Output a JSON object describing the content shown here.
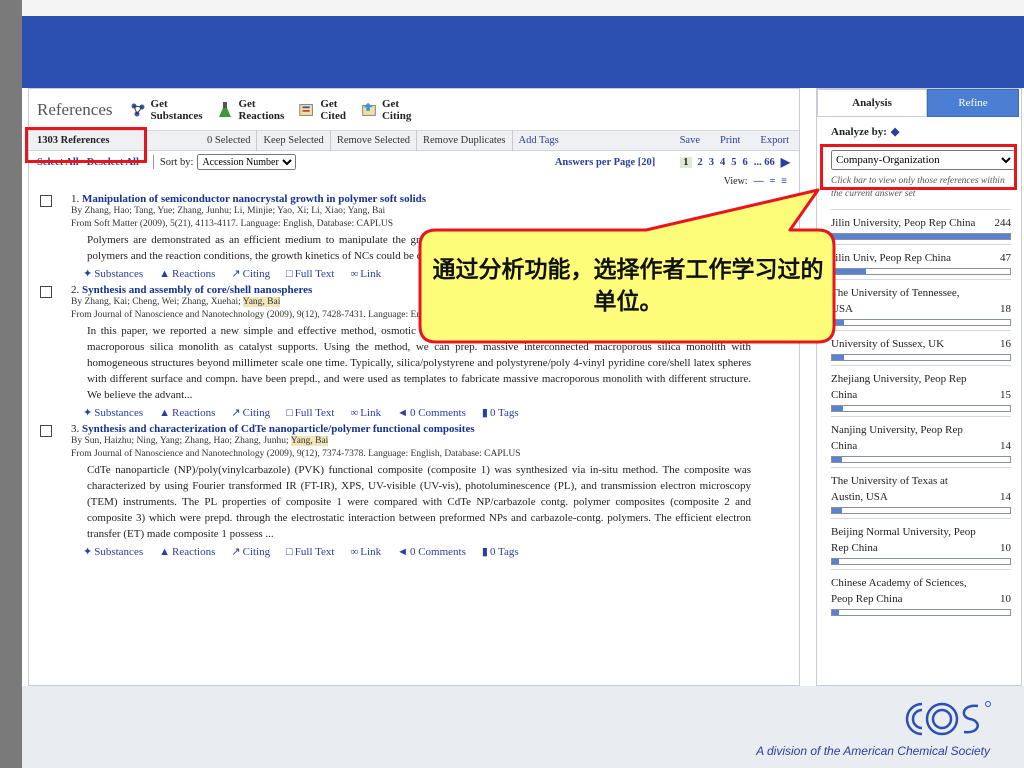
{
  "references_panel": {
    "title": "References",
    "get_buttons": [
      {
        "label": "Get\nSubstances",
        "icon": "flask-network-icon"
      },
      {
        "label": "Get\nReactions",
        "icon": "beaker-icon"
      },
      {
        "label": "Get\nCited",
        "icon": "cited-icon"
      },
      {
        "label": "Get\nCiting",
        "icon": "citing-icon"
      }
    ],
    "toolbar": {
      "count": "1303 References",
      "selected": "0 Selected",
      "keep": "Keep Selected",
      "remove": "Remove Selected",
      "remove_dup": "Remove Duplicates",
      "add_tags": "Add Tags",
      "save": "Save",
      "print": "Print",
      "export": "Export"
    },
    "sortbar": {
      "select_all": "Select All",
      "deselect_all": "Deselect All",
      "sort_by": "Sort by:",
      "sort_value": "Accession Number",
      "answers_per_page": "Answers per Page [20]",
      "pages": [
        "1",
        "2",
        "3",
        "4",
        "5",
        "6",
        "... 66"
      ]
    },
    "view_label": "View:",
    "references": [
      {
        "num": "1.",
        "title": "Manipulation of semiconductor nanocrystal growth in polymer soft solids",
        "authors": "By Zhang, Hao; Tang, Yue; Zhang, Junhu; Li, Minjie; Yao, Xi; Li, Xiao; Yang, Bai",
        "source": "From Soft Matter (2009), 5(21), 4113-4117. Language: English, Database: CAPLUS",
        "abstract": "Polymers are demonstrated as an efficient medium to manipulate the growth of semiconductor nanocrystals (NCs). By tuning the nature of the polymers and the reaction conditions, the growth kinetics of NCs could be controlled. This finding provides a new protocol for the synthesis of NCs.",
        "links": {
          "substances": "Substances",
          "reactions": "Reactions",
          "citing": "Citing",
          "full_text": "Full Text",
          "link": "Link",
          "comments": "0 Comments",
          "tags": "0 Tags"
        }
      },
      {
        "num": "2.",
        "title": "Synthesis and assembly of core/shell nanospheres",
        "authors_pre": "By Zhang, Kai; Cheng, Wei; Zhang, Xuehai;",
        "authors_hl": "Yang, Bai",
        "source": "From Journal of Nanoscience and Nanotechnology (2009), 9(12), 7428-7431. Language: English, Database: CAPLUS",
        "abstract": "In this paper, we reported a new simple and effective method, osmotic membrane-assisted self-assembly, for fabricating massive interconnected macroporous silica monolith as catalyst supports. Using the method, we can prep. massive interconnected macroporous silica monolith with homogeneous structures beyond millimeter scale one time. Typically, silica/polystyrene and polystyrene/poly 4-vinyl pyridine core/shell latex spheres with different surface and compn. have been prepd., and were used as templates to fabricate massive macroporous monolith with different structure. We believe the advant...",
        "links": {
          "substances": "Substances",
          "reactions": "Reactions",
          "citing": "Citing",
          "full_text": "Full Text",
          "link": "Link",
          "comments": "0 Comments",
          "tags": "0 Tags"
        }
      },
      {
        "num": "3.",
        "title": "Synthesis and characterization of CdTe nanoparticle/polymer functional composites",
        "authors_pre": "By Sun, Haizhu; Ning, Yang; Zhang, Hao; Zhang, Junhu;",
        "authors_hl": "Yang, Bai",
        "source": "From Journal of Nanoscience and Nanotechnology (2009), 9(12), 7374-7378. Language: English, Database: CAPLUS",
        "abstract": "CdTe nanoparticle (NP)/poly(vinylcarbazole) (PVK) functional composite (composite 1) was synthesized via in-situ method. The composite was characterized by using Fourier transformed IR (FT-IR), XPS, UV-visible (UV-vis), photoluminescence (PL), and transmission electron microscopy (TEM) instruments. The PL properties of composite 1 were compared with CdTe NP/carbazole contg. polymer composites (composite 2 and composite 3) which were prepd. through the electrostatic interaction between preformed NPs and carbazole-contg. polymers. The efficient electron transfer (ET) made composite 1 possess ...",
        "links": {
          "substances": "Substances",
          "reactions": "Reactions",
          "citing": "Citing",
          "full_text": "Full Text",
          "link": "Link",
          "comments": "0 Comments",
          "tags": "0 Tags"
        }
      }
    ]
  },
  "analysis_panel": {
    "tabs": [
      "Analysis",
      "Refine"
    ],
    "analyze_by": "Analyze by:",
    "selected_option": "Company-Organization",
    "hint": "Click bar to view only those references within the current answer set",
    "items": [
      {
        "name": "Jilin University, Peop Rep China",
        "count": "244",
        "fraction": 1.0
      },
      {
        "name": "Jilin Univ, Peop Rep China",
        "count": "47",
        "fraction": 0.19
      },
      {
        "name": "The University of Tennessee, USA",
        "count": "18",
        "fraction": 0.07
      },
      {
        "name": "University of Sussex, UK",
        "count": "16",
        "fraction": 0.066
      },
      {
        "name": "Zhejiang University, Peop Rep China",
        "count": "15",
        "fraction": 0.062
      },
      {
        "name": "Nanjing University, Peop Rep China",
        "count": "14",
        "fraction": 0.057
      },
      {
        "name": "The University of Texas at Austin, USA",
        "count": "14",
        "fraction": 0.057
      },
      {
        "name": "Beijing Normal University, Peop Rep China",
        "count": "10",
        "fraction": 0.041
      },
      {
        "name": "Chinese Academy of Sciences, Peop Rep China",
        "count": "10",
        "fraction": 0.041
      }
    ]
  },
  "callout": {
    "text": "通过分析功能，选择作者工作学习过的单位。"
  },
  "footer": {
    "text": "A division of the American Chemical Society",
    "logo": "cas-logo"
  },
  "colors": {
    "banner": "#2c50b2",
    "highlight_red": "#e8141e",
    "callout_fill": "#fdfd7a",
    "link_blue": "#2a3e9e"
  }
}
